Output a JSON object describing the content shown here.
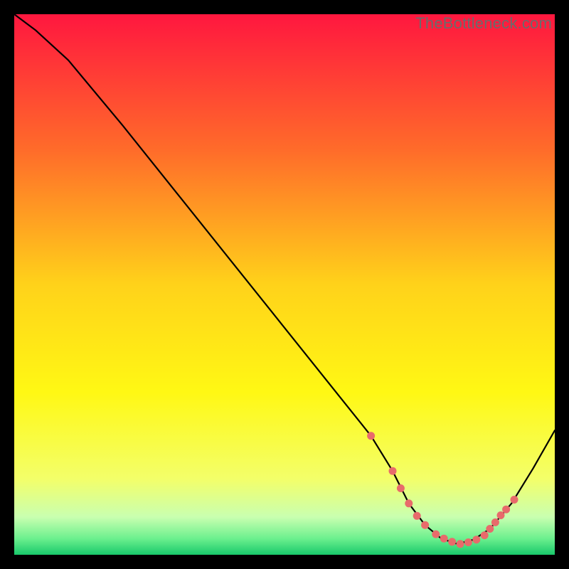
{
  "watermark": "TheBottleneck.com",
  "chart_data": {
    "type": "line",
    "title": "",
    "xlabel": "",
    "ylabel": "",
    "xlim": [
      0,
      100
    ],
    "ylim": [
      0,
      100
    ],
    "grid": false,
    "legend": false,
    "background_gradient": {
      "stops": [
        {
          "offset": 0.0,
          "color": "#ff173f"
        },
        {
          "offset": 0.25,
          "color": "#ff6b2a"
        },
        {
          "offset": 0.5,
          "color": "#ffd21a"
        },
        {
          "offset": 0.7,
          "color": "#fff814"
        },
        {
          "offset": 0.86,
          "color": "#f3ff6a"
        },
        {
          "offset": 0.93,
          "color": "#c9ffb0"
        },
        {
          "offset": 0.97,
          "color": "#6cf08e"
        },
        {
          "offset": 1.0,
          "color": "#18c96b"
        }
      ]
    },
    "series": [
      {
        "name": "bottleneck-curve",
        "x": [
          0,
          4,
          10,
          20,
          30,
          40,
          50,
          60,
          66,
          70,
          73,
          76,
          79,
          82,
          85,
          88,
          92,
          96,
          100
        ],
        "y": [
          100,
          97,
          91.5,
          79.5,
          67,
          54.5,
          42,
          29.5,
          22,
          15.5,
          9.5,
          5.5,
          3,
          2,
          2.8,
          4.8,
          9.5,
          16,
          23
        ]
      }
    ],
    "markers": {
      "name": "highlight-points",
      "color": "#e86b6b",
      "x": [
        66,
        70,
        71.5,
        73,
        74.5,
        76,
        78,
        79.5,
        81,
        82.5,
        84,
        85.5,
        87,
        88,
        89,
        90,
        91,
        92.5
      ],
      "y": [
        22,
        15.5,
        12.3,
        9.5,
        7.2,
        5.5,
        3.8,
        3,
        2.4,
        2,
        2.3,
        2.8,
        3.6,
        4.8,
        6,
        7.3,
        8.4,
        10.2
      ]
    }
  }
}
